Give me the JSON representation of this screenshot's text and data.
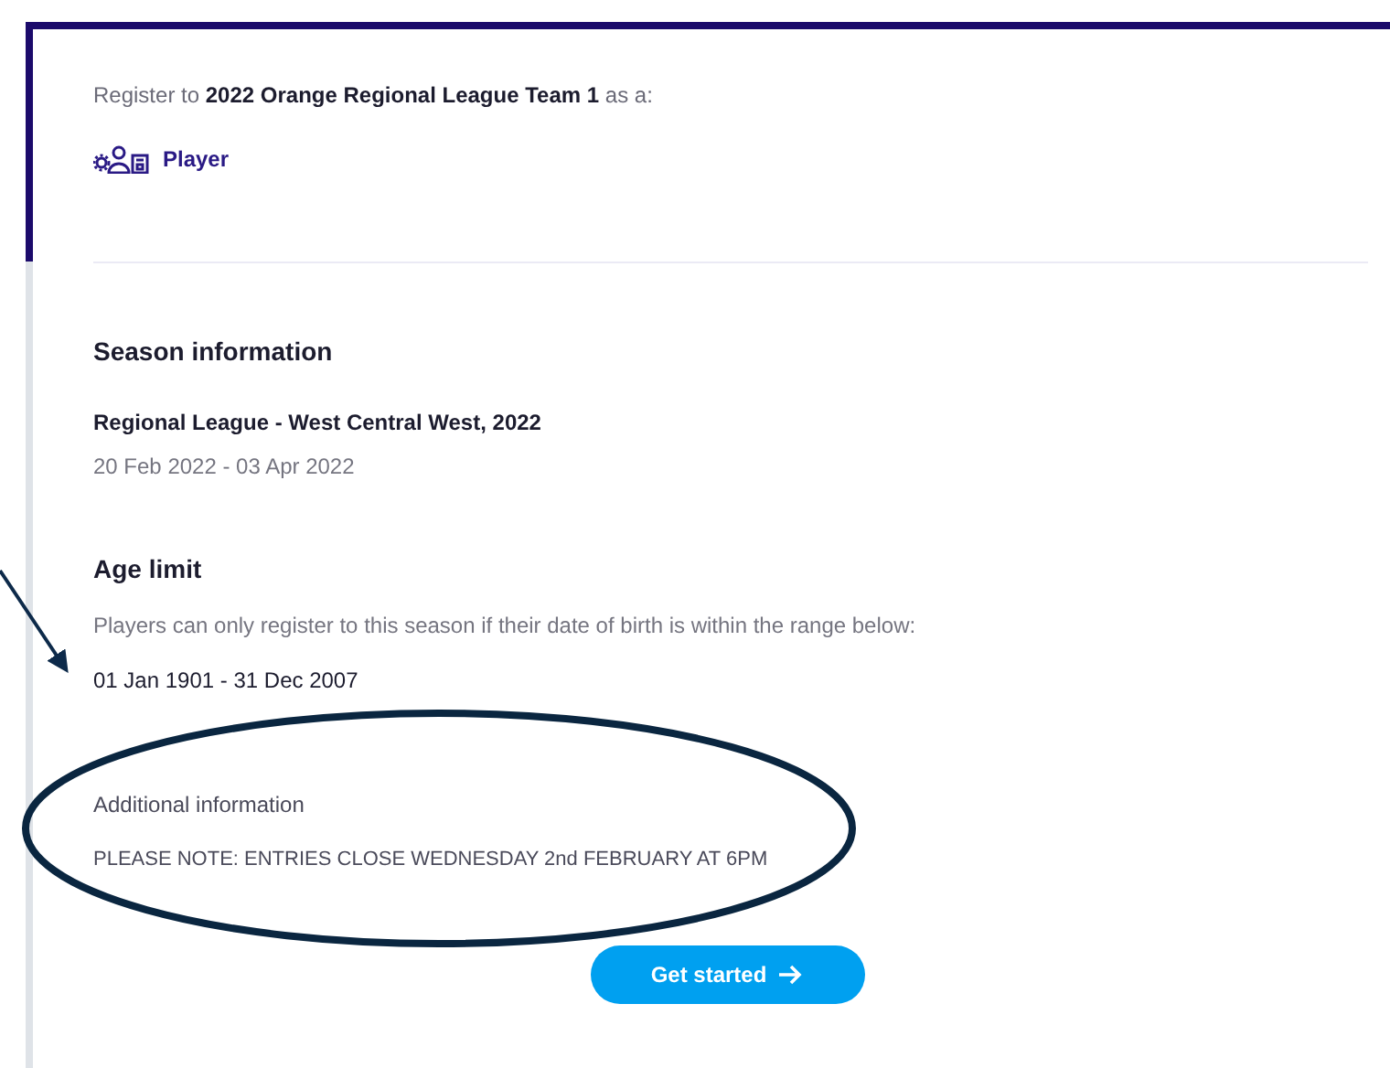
{
  "registration": {
    "intro": "Register to **2022 Orange Regional League Team 1** as a:",
    "roles": [
      {
        "label": "Player"
      }
    ]
  },
  "season": {
    "heading": "Season information",
    "name": "Regional League - West Central West, 2022",
    "dates": "20 Feb 2022 - 03 Apr 2022"
  },
  "age_limit": {
    "heading": "Age limit",
    "description": "Players can only register to this season if their date of birth is within the range below:",
    "range": "01 Jan 1901 - 31 Dec 2007"
  },
  "additional_information": {
    "heading": "Additional information",
    "note": "PLEASE NOTE: ENTRIES CLOSE WEDNESDAY 2nd FEBRUARY AT 6PM"
  },
  "button": {
    "label": "Get started"
  }
}
